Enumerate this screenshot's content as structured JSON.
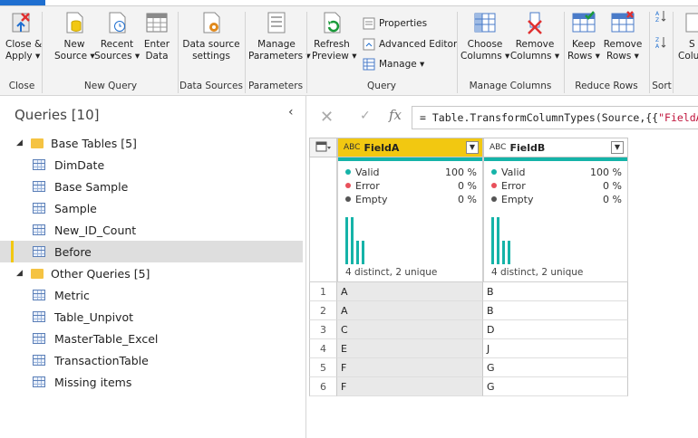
{
  "ribbon": {
    "buttons": [
      {
        "name": "close-apply",
        "line1": "Close &",
        "line2": "Apply ▾"
      },
      {
        "name": "new-source",
        "line1": "New",
        "line2": "Source ▾"
      },
      {
        "name": "recent-sources",
        "line1": "Recent",
        "line2": "Sources ▾"
      },
      {
        "name": "enter-data",
        "line1": "Enter",
        "line2": "Data"
      },
      {
        "name": "data-source-settings",
        "line1": "Data source",
        "line2": "settings"
      },
      {
        "name": "manage-parameters",
        "line1": "Manage",
        "line2": "Parameters ▾"
      },
      {
        "name": "refresh-preview",
        "line1": "Refresh",
        "line2": "Preview ▾"
      },
      {
        "name": "choose-columns",
        "line1": "Choose",
        "line2": "Columns ▾"
      },
      {
        "name": "remove-columns",
        "line1": "Remove",
        "line2": "Columns ▾"
      },
      {
        "name": "keep-rows",
        "line1": "Keep",
        "line2": "Rows ▾"
      },
      {
        "name": "remove-rows",
        "line1": "Remove",
        "line2": "Rows ▾"
      }
    ],
    "small": {
      "properties": "Properties",
      "advanced_editor": "Advanced Editor",
      "manage": "Manage ▾"
    },
    "partial": {
      "split_top": "S",
      "split_bottom": "Colu"
    },
    "groups": {
      "close": "Close",
      "new_query": "New Query",
      "data_sources": "Data Sources",
      "parameters": "Parameters",
      "query": "Query",
      "manage_columns": "Manage Columns",
      "reduce_rows": "Reduce Rows",
      "sort": "Sort"
    }
  },
  "queries": {
    "header": "Queries [10]",
    "groups": [
      {
        "label": "Base Tables [5]",
        "items": [
          "DimDate",
          "Base Sample",
          "Sample",
          "New_ID_Count",
          "Before"
        ]
      },
      {
        "label": "Other Queries [5]",
        "items": [
          "Metric",
          "Table_Unpivot",
          "MasterTable_Excel",
          "TransactionTable",
          "Missing items"
        ]
      }
    ],
    "selected": "Before"
  },
  "formula": {
    "prefix": "= Table.TransformColumnTypes(Source,{{",
    "string": "\"FieldA\""
  },
  "columns": [
    {
      "name": "FieldA",
      "type_icon": "ABC",
      "valid": "100 %",
      "error": "0 %",
      "empty": "0 %",
      "distinct": "4 distinct, 2 unique",
      "hist": [
        1.0,
        1.0,
        0.5,
        0.5
      ]
    },
    {
      "name": "FieldB",
      "type_icon": "ABC",
      "valid": "100 %",
      "error": "0 %",
      "empty": "0 %",
      "distinct": "4 distinct, 2 unique",
      "hist": [
        1.0,
        1.0,
        0.5,
        0.5
      ]
    }
  ],
  "profile_labels": {
    "valid": "Valid",
    "error": "Error",
    "empty": "Empty"
  },
  "rows": [
    {
      "n": "1",
      "a": "A",
      "b": "B"
    },
    {
      "n": "2",
      "a": "A",
      "b": "B"
    },
    {
      "n": "3",
      "a": "C",
      "b": "D"
    },
    {
      "n": "4",
      "a": "E",
      "b": "J"
    },
    {
      "n": "5",
      "a": "F",
      "b": "G"
    },
    {
      "n": "6",
      "a": "F",
      "b": "G"
    }
  ],
  "colors": {
    "accent": "#f2c811",
    "teal": "#15b3a8",
    "error": "#e8505b",
    "empty": "#555555"
  }
}
